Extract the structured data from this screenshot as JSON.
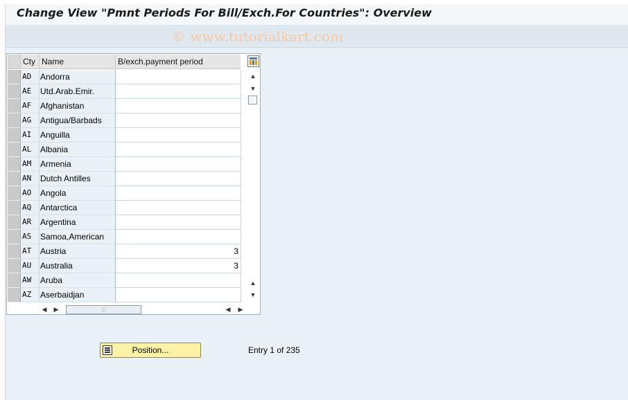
{
  "window": {
    "title": "Change View \"Pmnt Periods For Bill/Exch.For Countries\": Overview",
    "watermark": "© www.tutorialkart.com"
  },
  "table": {
    "columns": [
      "Cty",
      "Name",
      "B/exch.payment period"
    ],
    "rows": [
      {
        "cty": "AD",
        "name": "Andorra",
        "period": ""
      },
      {
        "cty": "AE",
        "name": "Utd.Arab.Emir.",
        "period": ""
      },
      {
        "cty": "AF",
        "name": "Afghanistan",
        "period": ""
      },
      {
        "cty": "AG",
        "name": "Antigua/Barbads",
        "period": ""
      },
      {
        "cty": "AI",
        "name": "Anguilla",
        "period": ""
      },
      {
        "cty": "AL",
        "name": "Albania",
        "period": ""
      },
      {
        "cty": "AM",
        "name": "Armenia",
        "period": ""
      },
      {
        "cty": "AN",
        "name": "Dutch Antilles",
        "period": ""
      },
      {
        "cty": "AO",
        "name": "Angola",
        "period": ""
      },
      {
        "cty": "AQ",
        "name": "Antarctica",
        "period": ""
      },
      {
        "cty": "AR",
        "name": "Argentina",
        "period": ""
      },
      {
        "cty": "AS",
        "name": "Samoa,American",
        "period": ""
      },
      {
        "cty": "AT",
        "name": "Austria",
        "period": "3"
      },
      {
        "cty": "AU",
        "name": "Australia",
        "period": "3"
      },
      {
        "cty": "AW",
        "name": "Aruba",
        "period": ""
      },
      {
        "cty": "AZ",
        "name": "Aserbaidjan",
        "period": ""
      }
    ]
  },
  "footer": {
    "position_button": "Position...",
    "entry_text": "Entry 1 of 235"
  },
  "icons": {
    "table_settings": "table-settings-icon",
    "position": "position-icon",
    "scroll_up": "▲",
    "scroll_down": "▼",
    "scroll_left": "◀",
    "scroll_right": "▶",
    "thumb_grip": ":::"
  }
}
